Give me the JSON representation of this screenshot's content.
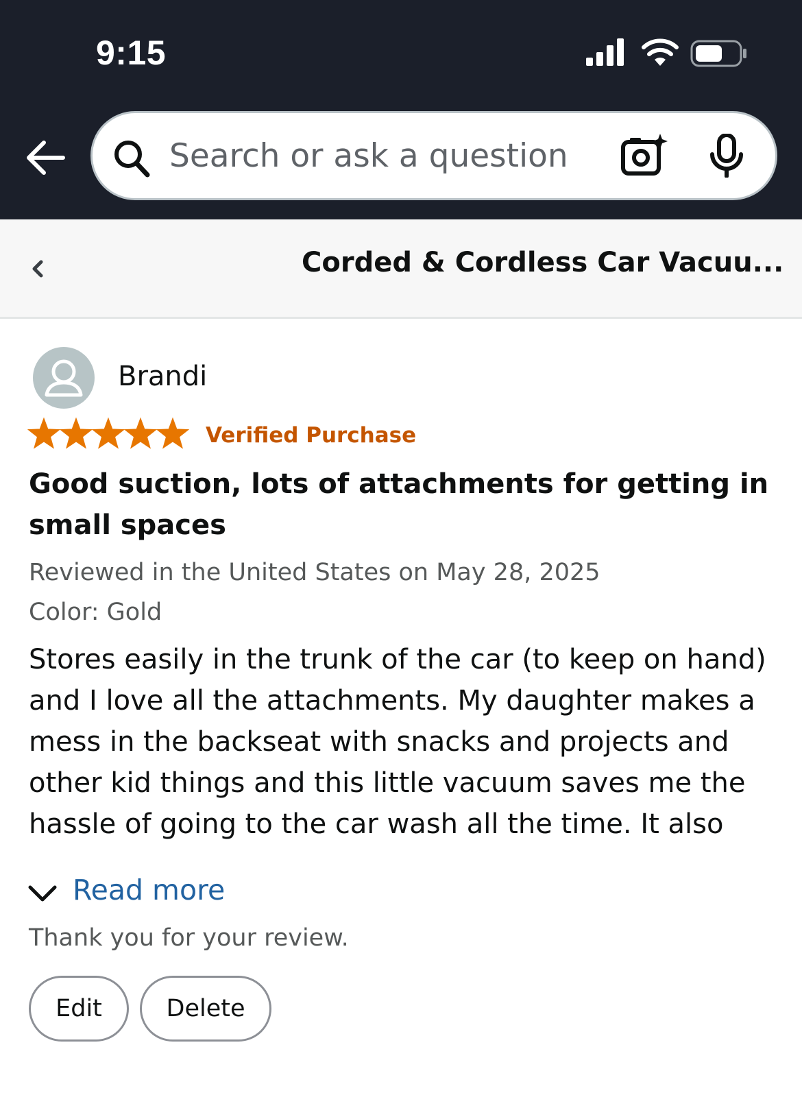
{
  "status_bar": {
    "time": "9:15",
    "icons": [
      "cellular-signal-icon",
      "wifi-icon",
      "battery-icon"
    ]
  },
  "header": {
    "back_icon": "back-arrow-icon",
    "search": {
      "placeholder": "Search or ask a question",
      "value": "",
      "icons": [
        "search-icon",
        "camera-icon",
        "microphone-icon"
      ]
    }
  },
  "subheader": {
    "back_icon": "chevron-left-icon",
    "title": "Corded & Cordless Car Vacuu..."
  },
  "review": {
    "reviewer_name": "Brandi",
    "avatar_icon": "user-avatar-icon",
    "rating": 5,
    "rating_max": 5,
    "verified_label": "Verified Purchase",
    "title": "Good suction, lots of attachments for getting in small spaces",
    "date_line": "Reviewed in the United States on May 28, 2025",
    "variant_line": "Color: Gold",
    "body": "Stores easily in the trunk of the car (to keep on hand) and I love all the attachments. My daughter makes a mess in the backseat with snacks and projects and other kid things and this little vacuum saves me the hassle of going to the car wash all the time. It also",
    "read_more_label": "Read more",
    "thanks_text": "Thank you for your review.",
    "edit_label": "Edit",
    "delete_label": "Delete"
  },
  "colors": {
    "top_bar": "#1b1f2a",
    "star": "#e77600",
    "verified": "#c45500",
    "link": "#2162a1",
    "muted_text": "#565959"
  }
}
